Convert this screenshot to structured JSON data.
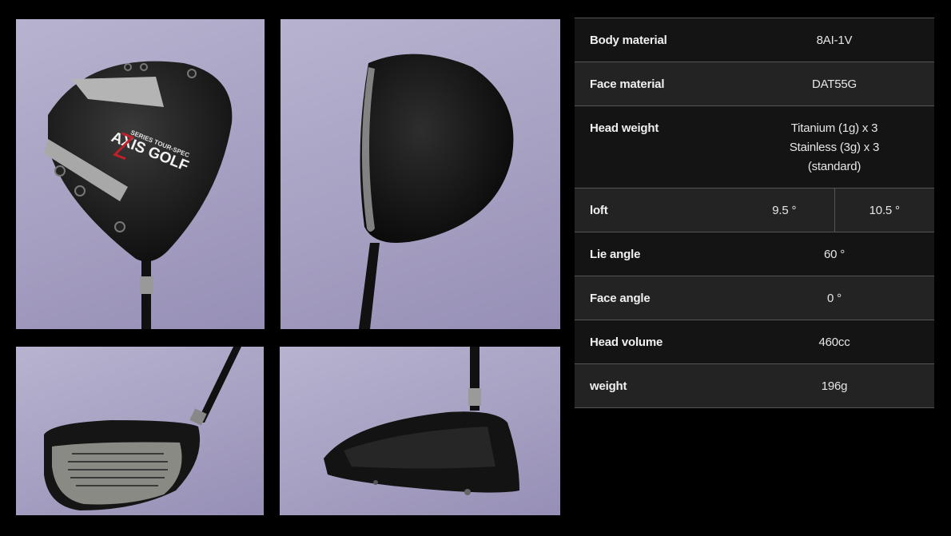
{
  "gallery": {
    "brand_text": "AXIS GOLF",
    "series_text": "SERIES TOUR-SPEC"
  },
  "specs": {
    "body_material": {
      "label": "Body material",
      "value": "8AI-1V"
    },
    "face_material": {
      "label": "Face material",
      "value": "DAT55G"
    },
    "head_weight": {
      "label": "Head weight",
      "lines": [
        "Titanium (1g) x 3",
        "Stainless (3g) x 3",
        "(standard)"
      ]
    },
    "loft": {
      "label": "loft",
      "values": [
        "9.5 °",
        "10.5 °"
      ]
    },
    "lie_angle": {
      "label": "Lie angle",
      "value": "60 °"
    },
    "face_angle": {
      "label": "Face angle",
      "value": "0 °"
    },
    "head_volume": {
      "label": "Head volume",
      "value": "460cc"
    },
    "weight": {
      "label": "weight",
      "value": "196g"
    }
  },
  "colors": {
    "background": "#000000",
    "photo_backdrop": "#a6a0c2",
    "row_dark": "#141414",
    "row_light": "#232323",
    "divider": "#555555"
  }
}
